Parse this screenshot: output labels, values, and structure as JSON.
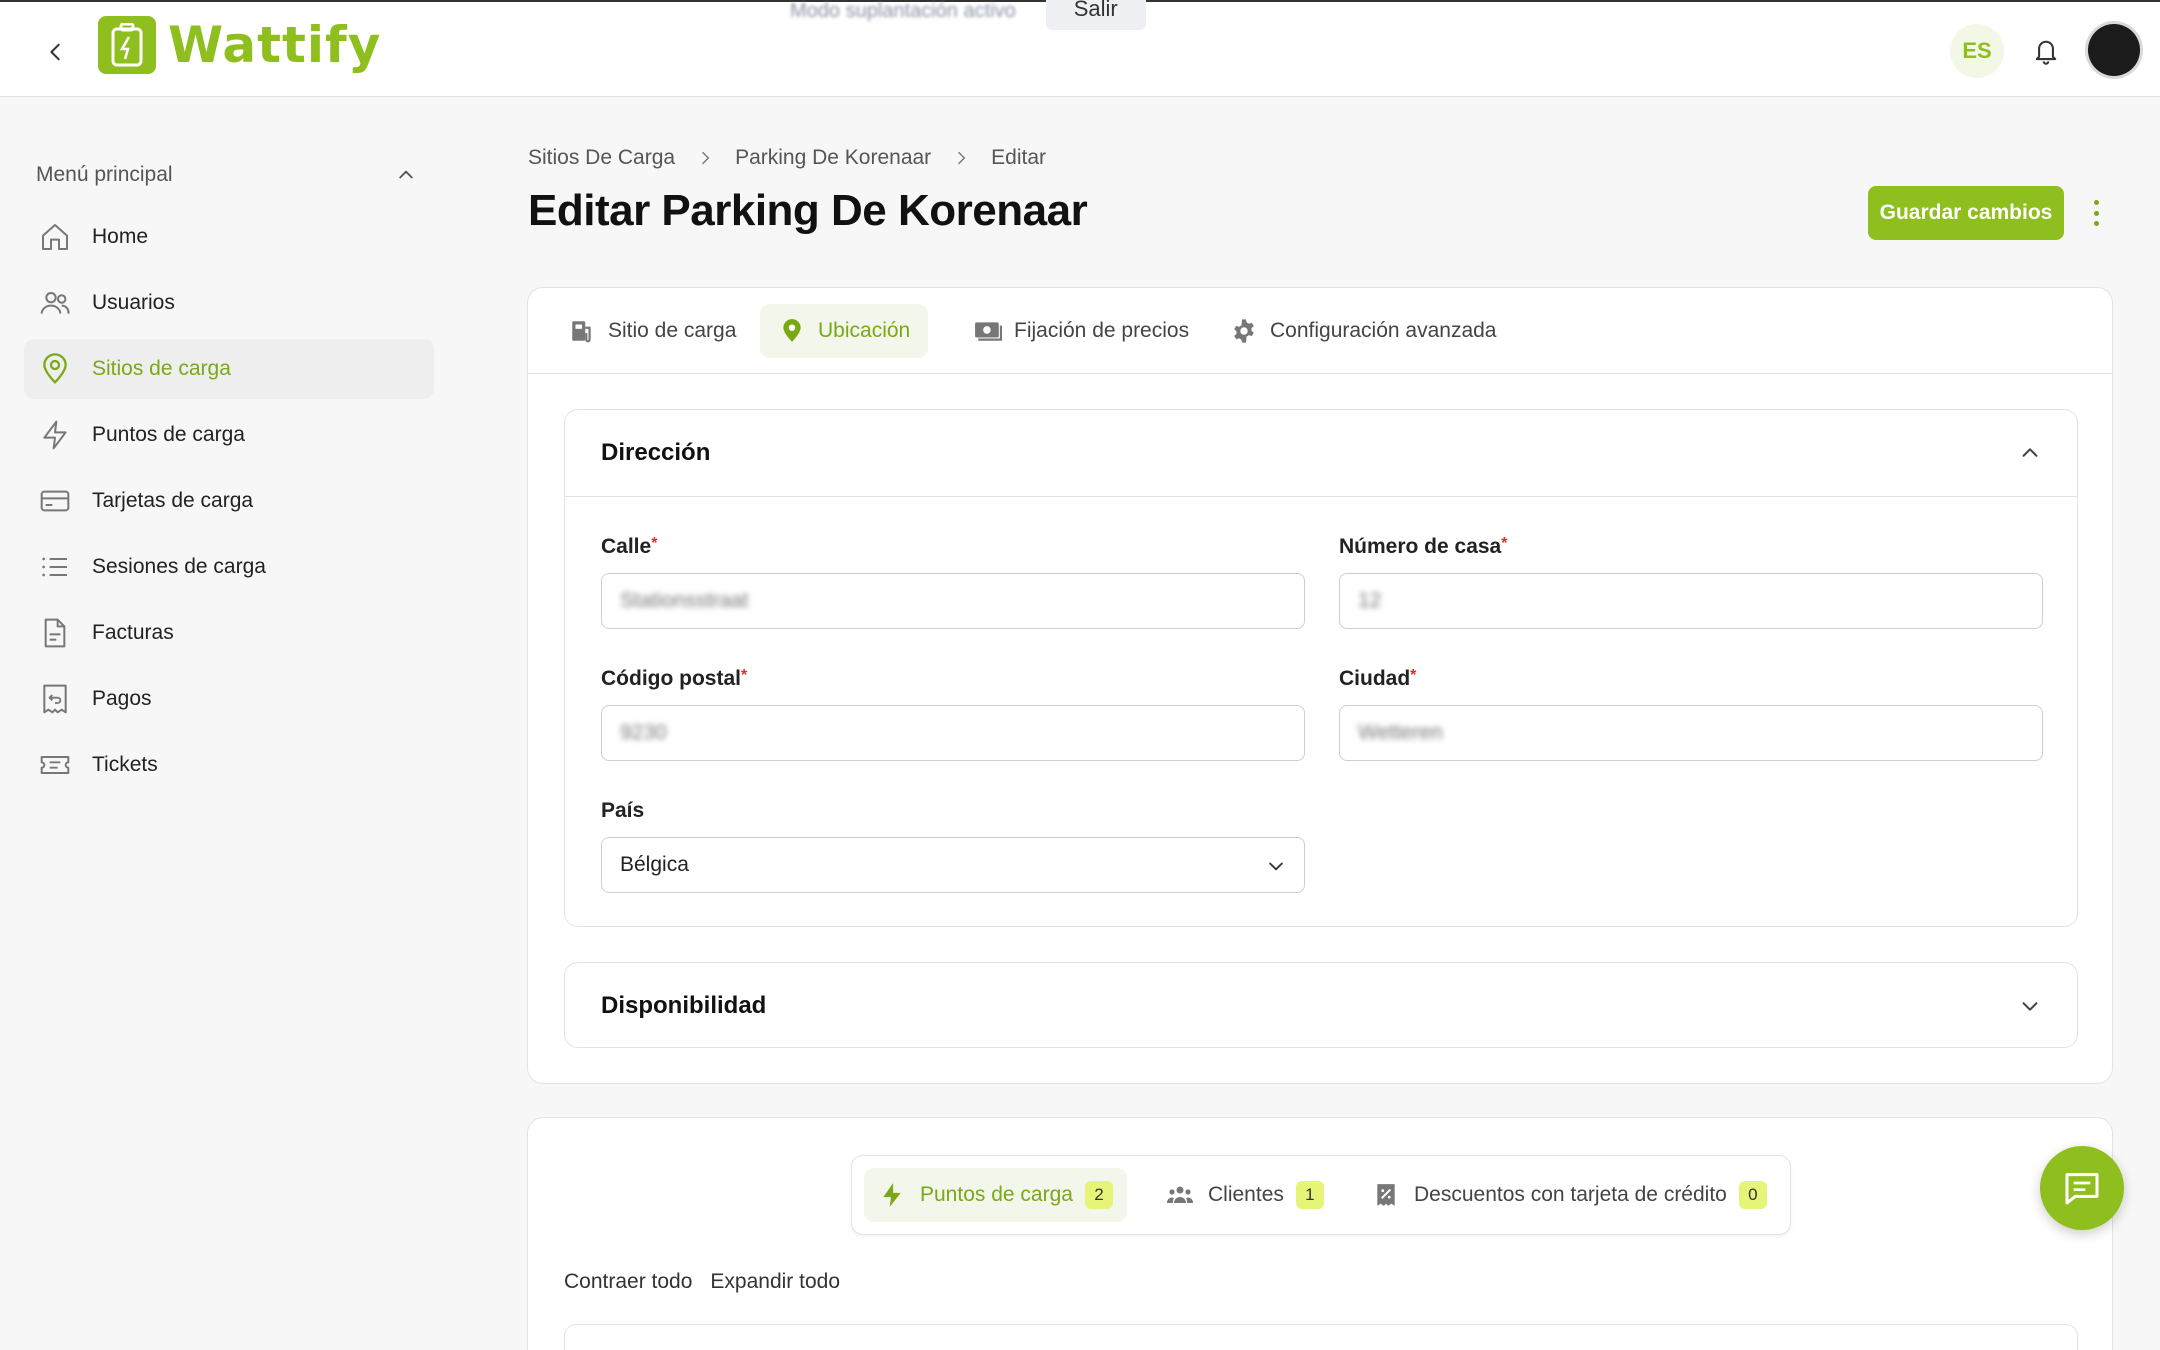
{
  "header": {
    "app_name": "Wattify",
    "banner_text": "Modo suplantación activo",
    "banner_button": "Salir",
    "language": "ES"
  },
  "sidebar": {
    "menu_title": "Menú principal",
    "items": [
      {
        "label": "Home",
        "icon": "home-icon"
      },
      {
        "label": "Usuarios",
        "icon": "users-icon"
      },
      {
        "label": "Sitios de carga",
        "icon": "map-pin-icon",
        "active": true
      },
      {
        "label": "Puntos de carga",
        "icon": "lightning-icon"
      },
      {
        "label": "Tarjetas de carga",
        "icon": "card-icon"
      },
      {
        "label": "Sesiones de carga",
        "icon": "list-icon"
      },
      {
        "label": "Facturas",
        "icon": "document-icon"
      },
      {
        "label": "Pagos",
        "icon": "receipt-icon"
      },
      {
        "label": "Tickets",
        "icon": "ticket-icon"
      }
    ]
  },
  "breadcrumb": [
    "Sitios De Carga",
    "Parking De Korenaar",
    "Editar"
  ],
  "page": {
    "title": "Editar Parking De Korenaar",
    "save_label": "Guardar cambios"
  },
  "tabs": [
    {
      "label": "Sitio de carga",
      "icon": "building-icon"
    },
    {
      "label": "Ubicación",
      "icon": "location-icon",
      "active": true
    },
    {
      "label": "Fijación de precios",
      "icon": "money-icon"
    },
    {
      "label": "Configuración avanzada",
      "icon": "gear-icon"
    }
  ],
  "address_section": {
    "title": "Dirección",
    "street_label": "Calle",
    "street_value": "Stationsstraat",
    "house_label": "Número de casa",
    "house_value": "12",
    "postal_label": "Código postal",
    "postal_value": "9230",
    "city_label": "Ciudad",
    "city_value": "Wetteren",
    "country_label": "País",
    "country_value": "Bélgica"
  },
  "availability_section": {
    "title": "Disponibilidad"
  },
  "subtabs": [
    {
      "label": "Puntos de carga",
      "count": "2",
      "icon": "lightning-icon",
      "active": true
    },
    {
      "label": "Clientes",
      "count": "1",
      "icon": "users-group-icon"
    },
    {
      "label": "Descuentos con tarjeta de crédito",
      "count": "0",
      "icon": "discount-icon"
    }
  ],
  "collapse_all": "Contraer todo",
  "expand_all": "Expandir todo",
  "colors": {
    "accent": "#8fbf1e",
    "accent_text": "#7aa816",
    "badge": "#e6f577",
    "required": "#d93025"
  }
}
